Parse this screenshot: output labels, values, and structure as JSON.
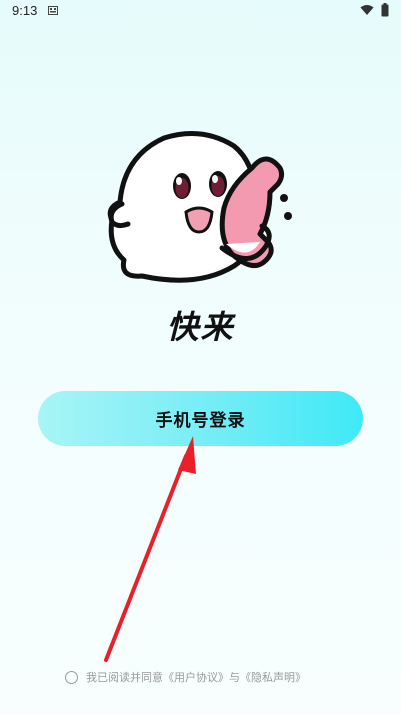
{
  "status_bar": {
    "time": "9:13",
    "icons": [
      "notification-icon",
      "wifi-icon",
      "battery-icon"
    ]
  },
  "app": {
    "name": "快来",
    "mascot": "ghost-phone-mascot"
  },
  "login": {
    "button_label": "手机号登录"
  },
  "agreement": {
    "prefix": "我已阅读并同意",
    "user_agreement": "《用户协议》",
    "conjunction": "与",
    "privacy_statement": "《隐私声明》"
  },
  "colors": {
    "button_gradient_start": "#a8f5f5",
    "button_gradient_end": "#3fe9f7",
    "arrow": "#e8202a",
    "phone_pink": "#f49ab0"
  }
}
